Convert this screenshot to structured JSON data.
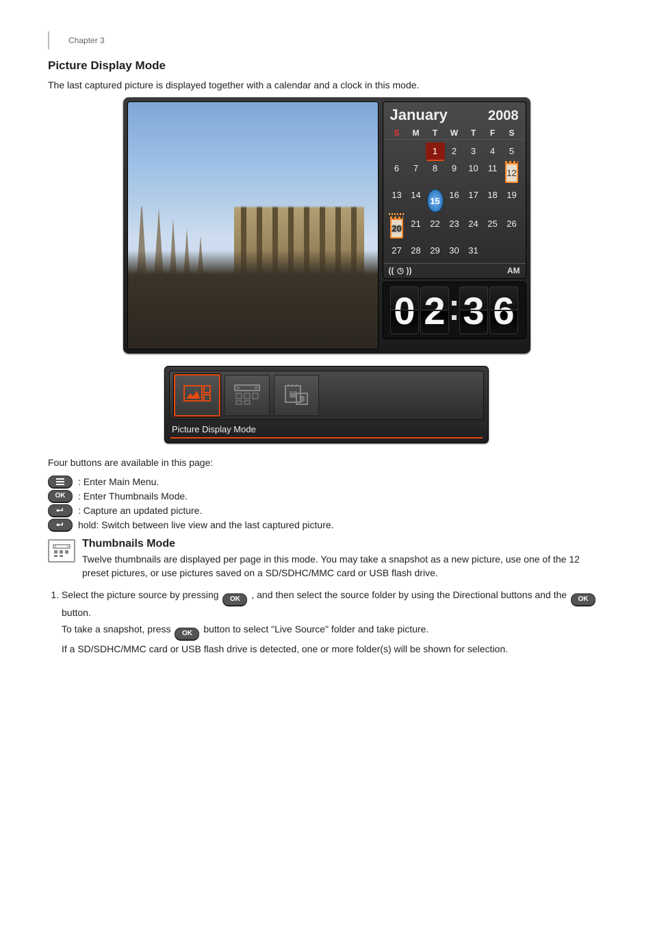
{
  "header": "Chapter 3",
  "section_title": "Picture Display Mode",
  "intro": "The last captured picture is displayed together with a calendar and a clock in this mode.",
  "calendar": {
    "month": "January",
    "year": "2008",
    "dow": [
      "S",
      "M",
      "T",
      "W",
      "T",
      "F",
      "S"
    ],
    "days": [
      [
        "",
        "",
        "1",
        "2",
        "3",
        "4",
        "5"
      ],
      [
        "6",
        "7",
        "8",
        "9",
        "10",
        "11",
        "12"
      ],
      [
        "13",
        "14",
        "15",
        "16",
        "17",
        "18",
        "19"
      ],
      [
        "20",
        "21",
        "22",
        "23",
        "24",
        "25",
        "26"
      ],
      [
        "27",
        "28",
        "29",
        "30",
        "31",
        "",
        ""
      ]
    ],
    "selected": "1",
    "framed": [
      "12",
      "20"
    ],
    "badge": [
      "20"
    ],
    "marker": "15",
    "ampm": "AM",
    "time": [
      "0",
      "2",
      "3",
      "6"
    ]
  },
  "mode_label": "Picture Display Mode",
  "btn_intro": "Four buttons are available in this page:",
  "buttons": {
    "menu": ": Enter Main Menu.",
    "ok": ": Enter Thumbnails Mode.",
    "enter": ": Capture an updated picture.",
    "enter_hold": "hold: Switch between live view and the last captured picture."
  },
  "pill": {
    "ok": "OK"
  },
  "thumb": {
    "title": "Thumbnails Mode",
    "intro": "Twelve thumbnails are displayed per page in this mode. You may take a snapshot as a new picture, use one of the 12 preset pictures, or use pictures saved on a SD/SDHC/MMC card or USB flash drive.",
    "step1a": "Select the picture source by pressing ",
    "step1b": ", and then select the source folder by using the Directional buttons and the ",
    "step1c": " button.",
    "step2a": "To take a snapshot, press ",
    "step2b": " button to select \"Live Source\" folder and take picture.",
    "step3": "If a SD/SDHC/MMC card or USB flash drive is detected, one or more folder(s) will be shown for selection."
  }
}
